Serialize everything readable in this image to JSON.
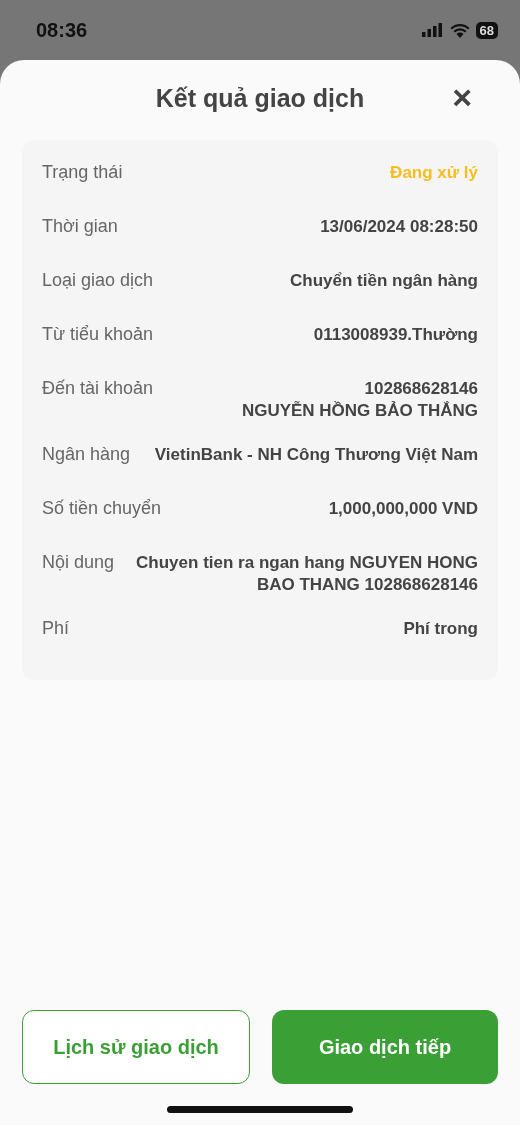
{
  "status_bar": {
    "time": "08:36",
    "battery": "68"
  },
  "sheet": {
    "title": "Kết quả giao dịch",
    "close": "×"
  },
  "details": [
    {
      "label": "Trạng thái",
      "values": [
        "Đang xử lý"
      ],
      "color": "#f5bd1f"
    },
    {
      "label": "Thời gian",
      "values": [
        "13/06/2024 08:28:50"
      ]
    },
    {
      "label": "Loại giao dịch",
      "values": [
        "Chuyển tiền ngân hàng"
      ]
    },
    {
      "label": "Từ tiểu khoản",
      "values": [
        "0113008939.Thường"
      ]
    },
    {
      "label": "Đến tài khoản",
      "values": [
        "102868628146",
        "NGUYỄN HỒNG BẢO THẮNG"
      ]
    },
    {
      "label": "Ngân hàng",
      "values": [
        "VietinBank - NH Công Thương Việt Nam"
      ]
    },
    {
      "label": "Số tiền chuyển",
      "values": [
        "1,000,000,000 VND"
      ]
    },
    {
      "label": "Nội dung",
      "values": [
        "Chuyen tien ra ngan hang NGUYEN HONG BAO THANG 102868628146"
      ]
    },
    {
      "label": "Phí",
      "values": [
        "Phí trong"
      ]
    }
  ],
  "buttons": [
    {
      "label": "Lịch sử giao dịch",
      "kind": "outline"
    },
    {
      "label": "Giao dịch tiếp",
      "kind": "filled"
    }
  ]
}
